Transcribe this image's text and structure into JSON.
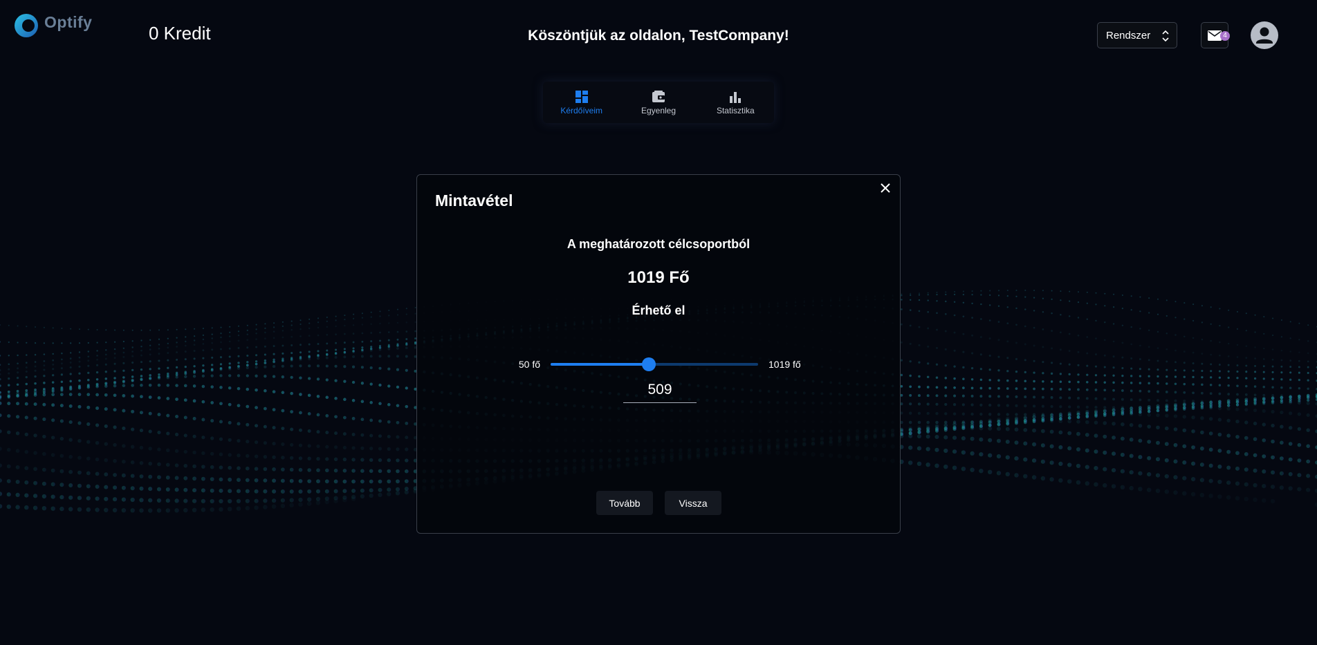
{
  "app": {
    "logo_text": "Optify",
    "credits": "0 Kredit",
    "welcome": "Köszöntjük az oldalon, TestCompany!"
  },
  "header": {
    "system_select": {
      "value": "Rendszer"
    },
    "mail": {
      "badge_count": "4"
    }
  },
  "nav": {
    "items": [
      {
        "label": "Kérdőíveim",
        "icon": "dashboard-icon",
        "active": true
      },
      {
        "label": "Egyenleg",
        "icon": "wallet-icon",
        "active": false
      },
      {
        "label": "Statisztika",
        "icon": "bar-chart-icon",
        "active": false
      }
    ]
  },
  "modal": {
    "title": "Mintavétel",
    "line1": "A meghatározott célcsoportból",
    "line2": "1019 Fő",
    "line3": "Érhető el",
    "slider": {
      "min_label": "50 fő",
      "max_label": "1019 fő",
      "min": 50,
      "max": 1019,
      "value": 509
    },
    "input_value": "509",
    "next_label": "Tovább",
    "back_label": "Vissza"
  },
  "colors": {
    "accent": "#1e7ef0",
    "background": "#050811",
    "badge": "#a770c9"
  }
}
